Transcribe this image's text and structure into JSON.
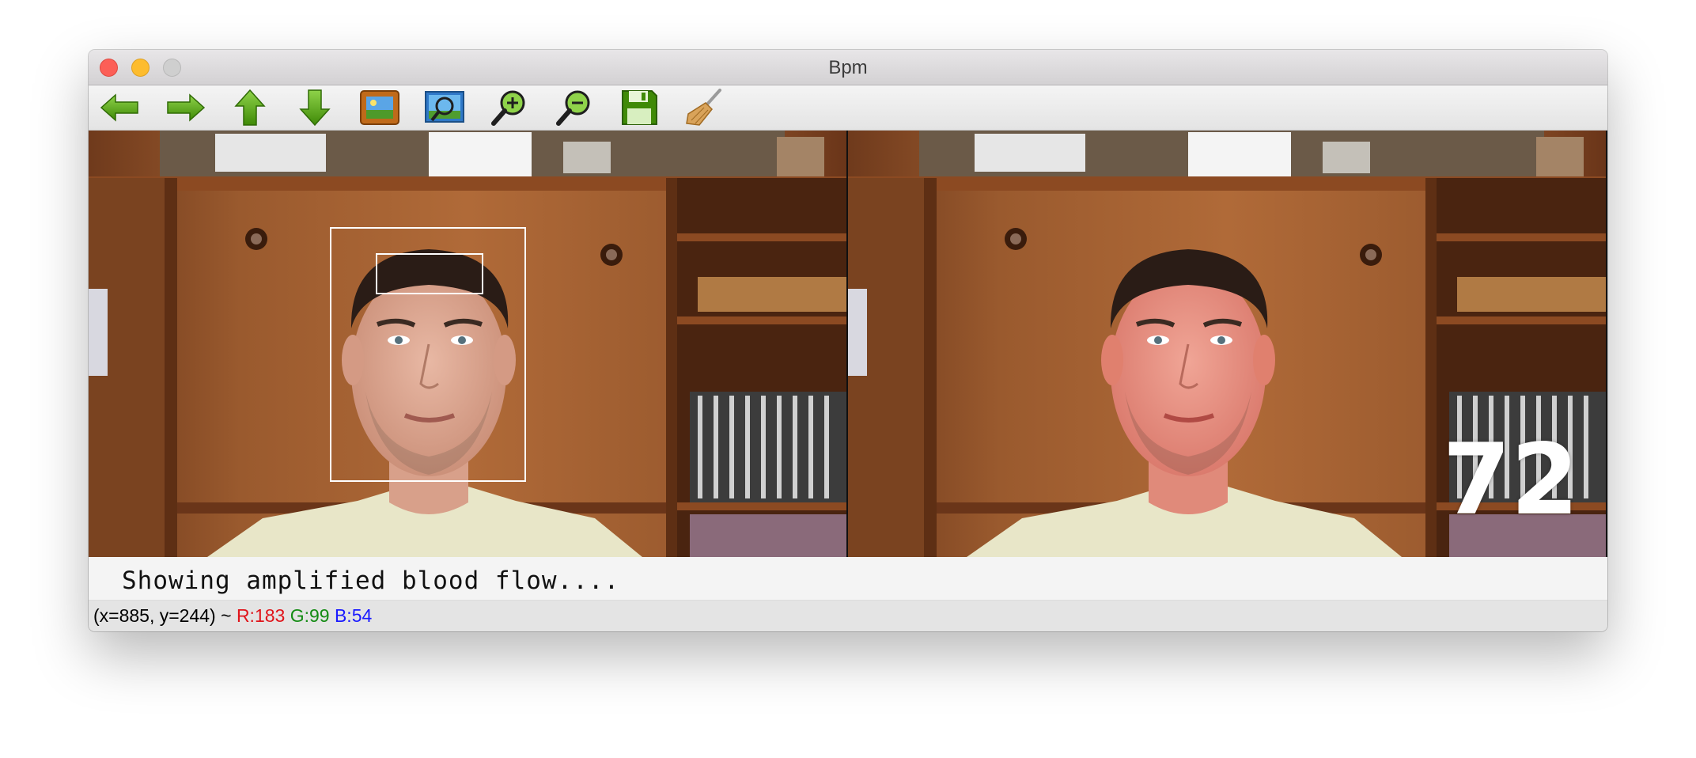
{
  "window": {
    "title": "Bpm"
  },
  "toolbar": {
    "buttons": [
      {
        "name": "back-arrow",
        "icon": "arrow-left-icon"
      },
      {
        "name": "forward-arrow",
        "icon": "arrow-right-icon"
      },
      {
        "name": "up-arrow",
        "icon": "arrow-up-icon"
      },
      {
        "name": "down-arrow",
        "icon": "arrow-down-icon"
      },
      {
        "name": "image",
        "icon": "image-icon"
      },
      {
        "name": "zoom-fit",
        "icon": "zoom-image-icon"
      },
      {
        "name": "zoom-in",
        "icon": "zoom-in-icon"
      },
      {
        "name": "zoom-out",
        "icon": "zoom-out-icon"
      },
      {
        "name": "save",
        "icon": "floppy-disk-icon"
      },
      {
        "name": "clear",
        "icon": "broom-icon"
      }
    ]
  },
  "overlay": {
    "bpm_value": "72"
  },
  "caption": {
    "text": "Showing amplified blood flow...."
  },
  "status": {
    "coords": "(x=885, y=244) ~ ",
    "r": "R:183",
    "g": "G:99",
    "b": "B:54"
  },
  "colors": {
    "arrow_green": "#4e9a06",
    "r_color": "#e0141a",
    "g_color": "#138b13",
    "b_color": "#1a1aff"
  }
}
